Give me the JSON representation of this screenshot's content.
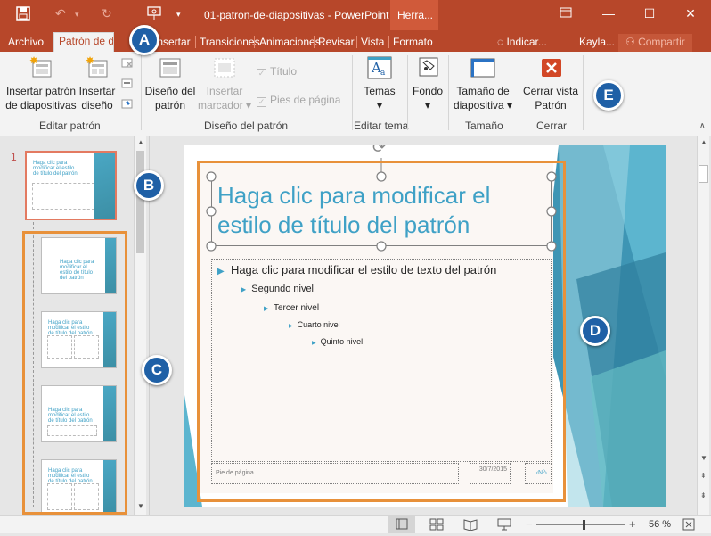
{
  "titlebar": {
    "title": "01-patron-de-diapositivas - PowerPoint",
    "context_tab": "Herra..."
  },
  "tabs": [
    "Archivo",
    "Patrón de d",
    "Insertar",
    "Transiciones",
    "Animaciones",
    "Revisar",
    "Vista",
    "Formato"
  ],
  "tabs_right": {
    "tell_me": "Indicar...",
    "user": "Kayla...",
    "share": "Compartir"
  },
  "ribbon": {
    "insert_slide_master": "Insertar patrón de diapositivas",
    "insert_layout": "Insertar diseño",
    "group_edit_master": "Editar patrón",
    "master_layout": "Diseño del patrón",
    "insert_placeholder": "Insertar marcador",
    "title_chk": "Título",
    "footers_chk": "Pies de página",
    "group_master_layout": "Diseño del patrón",
    "themes": "Temas",
    "group_edit_theme": "Editar tema",
    "background": "Fondo",
    "slide_size": "Tamaño de diapositiva",
    "group_size": "Tamaño",
    "close_master": "Cerrar vista Patrón",
    "group_close": "Cerrar"
  },
  "thumbs": {
    "number": "1",
    "master_title": "Haga clic para modificar el estilo de título del patrón",
    "layout_title_1": "Haga clic para modificar el estilo de título del patrón",
    "layout_title_2": "Haga clic para modificar el estilo de título del patrón",
    "layout_title_3": "Haga clic para modificar el estilo de título del patrón",
    "layout_title_4": "Haga clic para modificar el estilo de título del patrón"
  },
  "slide": {
    "title": "Haga clic para modificar el estilo de título del patrón",
    "level1": "Haga clic para modificar el estilo de texto del patrón",
    "level2": "Segundo nivel",
    "level3": "Tercer nivel",
    "level4": "Cuarto nivel",
    "level5": "Quinto nivel",
    "footer": "Pie de página",
    "date": "30/7/2015",
    "slide_num": "‹Nº›"
  },
  "status": {
    "zoom": "56 %"
  },
  "callouts": [
    "A",
    "B",
    "C",
    "D",
    "E"
  ],
  "colors": {
    "accent": "#b7472a",
    "callout": "#1f60a6",
    "highlight": "#e8913a",
    "title_text": "#3fa1c6"
  }
}
